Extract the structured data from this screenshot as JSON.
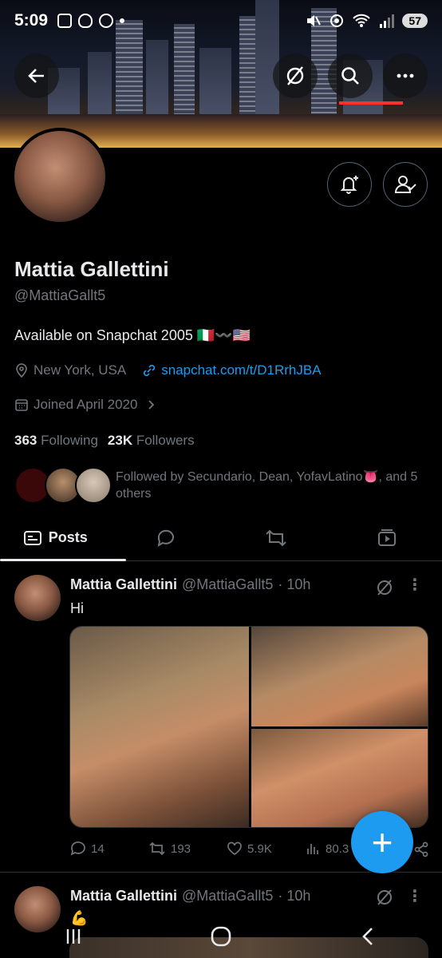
{
  "status_bar": {
    "time": "5:09",
    "battery": "57",
    "signal": "5"
  },
  "profile": {
    "name": "Mattia Gallettini",
    "handle": "@MattiaGallt5",
    "bio": "Available on Snapchat  2005 🇮🇹〰️🇺🇸",
    "location": "New York, USA",
    "link": "snapchat.com/t/D1RrhJBA",
    "joined": "Joined April 2020",
    "following_count": "363",
    "following_label": "Following",
    "followers_count": "23K",
    "followers_label": "Followers",
    "followed_by": "Followed by Secundario, Dean, YofavLatino👅, and 5 others"
  },
  "tabs": [
    {
      "label": "Posts",
      "icon": "posts-icon"
    },
    {
      "label": "",
      "icon": "replies-icon"
    },
    {
      "label": "",
      "icon": "repost-icon"
    },
    {
      "label": "",
      "icon": "media-icon"
    }
  ],
  "posts": [
    {
      "name": "Mattia Gallettini",
      "handle": "@MattiaGallt5",
      "time": "· 10h",
      "text": "Hi",
      "replies": "14",
      "reposts": "193",
      "likes": "5.9K",
      "views": "80.3"
    },
    {
      "name": "Mattia Gallettini",
      "handle": "@MattiaGallt5",
      "time": "· 10h",
      "text": "💪"
    }
  ],
  "fab_label": "+",
  "colors": {
    "accent": "#1d9bf0",
    "background": "#000000",
    "secondary_text": "#71767b"
  }
}
